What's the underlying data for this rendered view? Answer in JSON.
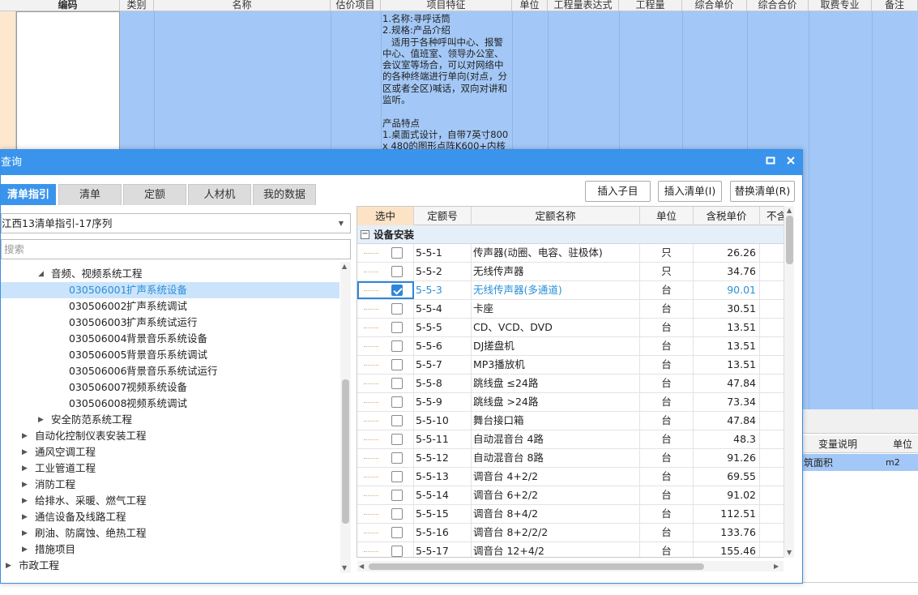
{
  "background": {
    "columns": [
      "编码",
      "类别",
      "名称",
      "估价项目",
      "项目特征",
      "单位",
      "工程量表达式",
      "工程量",
      "综合单价",
      "综合合价",
      "取费专业",
      "备注"
    ],
    "feature_text": "1.名称:寻呼话筒\n2.规格:产品介绍\n   适用于各种呼叫中心、报警中心、值班室、领导办公室、会议室等场合，可以对网络中的各种终端进行单向(对点，分区或者全区)喊话，双向对讲和监听。\n\n产品特点\n1.桌面式设计，自带7英寸800 x 480的图形点阵K600+内核",
    "lower_headers": [
      "变量说明",
      "单位"
    ],
    "lower_row": [
      "筑面积",
      "m2"
    ]
  },
  "dialog": {
    "title": "查询",
    "tabs": [
      "清单指引",
      "清单",
      "定额",
      "人材机",
      "我的数据"
    ],
    "buttons": {
      "insert_child": "插入子目",
      "insert_list": "插入清单(I)",
      "replace_list": "替换清单(R)"
    },
    "dropdown_value": "江西13清单指引-17序列",
    "search_placeholder": "搜索",
    "tree": [
      {
        "arrow": "◢",
        "code": "",
        "label": "音频、视频系统工程",
        "level": 2
      },
      {
        "arrow": "",
        "code": "030506001",
        "label": "扩声系统设备",
        "level": 3,
        "selected": true
      },
      {
        "arrow": "",
        "code": "030506002",
        "label": "扩声系统调试",
        "level": 3
      },
      {
        "arrow": "",
        "code": "030506003",
        "label": "扩声系统试运行",
        "level": 3
      },
      {
        "arrow": "",
        "code": "030506004",
        "label": "背景音乐系统设备",
        "level": 3
      },
      {
        "arrow": "",
        "code": "030506005",
        "label": "背景音乐系统调试",
        "level": 3
      },
      {
        "arrow": "",
        "code": "030506006",
        "label": "背景音乐系统试运行",
        "level": 3
      },
      {
        "arrow": "",
        "code": "030506007",
        "label": "视频系统设备",
        "level": 3
      },
      {
        "arrow": "",
        "code": "030506008",
        "label": "视频系统调试",
        "level": 3
      },
      {
        "arrow": "▶",
        "code": "",
        "label": "安全防范系统工程",
        "level": 2
      },
      {
        "arrow": "▶",
        "code": "",
        "label": "自动化控制仪表安装工程",
        "level": 1
      },
      {
        "arrow": "▶",
        "code": "",
        "label": "通风空调工程",
        "level": 1
      },
      {
        "arrow": "▶",
        "code": "",
        "label": "工业管道工程",
        "level": 1
      },
      {
        "arrow": "▶",
        "code": "",
        "label": "消防工程",
        "level": 1
      },
      {
        "arrow": "▶",
        "code": "",
        "label": "给排水、采暖、燃气工程",
        "level": 1
      },
      {
        "arrow": "▶",
        "code": "",
        "label": "通信设备及线路工程",
        "level": 1
      },
      {
        "arrow": "▶",
        "code": "",
        "label": "刷油、防腐蚀、绝热工程",
        "level": 1
      },
      {
        "arrow": "▶",
        "code": "",
        "label": "措施项目",
        "level": 1
      },
      {
        "arrow": "▶",
        "code": "",
        "label": "市政工程",
        "level": 0
      }
    ],
    "grid": {
      "headers": [
        "选中",
        "定额号",
        "定额名称",
        "单位",
        "含税单价",
        "不含"
      ],
      "group": "设备安装",
      "rows": [
        {
          "code": "5-5-1",
          "name": "传声器(动圈、电容、驻极体)",
          "unit": "只",
          "price": "26.26",
          "checked": false
        },
        {
          "code": "5-5-2",
          "name": "无线传声器",
          "unit": "只",
          "price": "34.76",
          "checked": false
        },
        {
          "code": "5-5-3",
          "name": "无线传声器(多通道)",
          "unit": "台",
          "price": "90.01",
          "checked": true
        },
        {
          "code": "5-5-4",
          "name": "卡座",
          "unit": "台",
          "price": "30.51",
          "checked": false
        },
        {
          "code": "5-5-5",
          "name": "CD、VCD、DVD",
          "unit": "台",
          "price": "13.51",
          "checked": false
        },
        {
          "code": "5-5-6",
          "name": "DJ搓盘机",
          "unit": "台",
          "price": "13.51",
          "checked": false
        },
        {
          "code": "5-5-7",
          "name": "MP3播放机",
          "unit": "台",
          "price": "13.51",
          "checked": false
        },
        {
          "code": "5-5-8",
          "name": "跳线盘 ≤24路",
          "unit": "台",
          "price": "47.84",
          "checked": false
        },
        {
          "code": "5-5-9",
          "name": "跳线盘 >24路",
          "unit": "台",
          "price": "73.34",
          "checked": false
        },
        {
          "code": "5-5-10",
          "name": "舞台接口箱",
          "unit": "台",
          "price": "47.84",
          "checked": false
        },
        {
          "code": "5-5-11",
          "name": "自动混音台 4路",
          "unit": "台",
          "price": "48.3",
          "checked": false
        },
        {
          "code": "5-5-12",
          "name": "自动混音台 8路",
          "unit": "台",
          "price": "91.26",
          "checked": false
        },
        {
          "code": "5-5-13",
          "name": "调音台 4+2/2",
          "unit": "台",
          "price": "69.55",
          "checked": false
        },
        {
          "code": "5-5-14",
          "name": "调音台 6+2/2",
          "unit": "台",
          "price": "91.02",
          "checked": false
        },
        {
          "code": "5-5-15",
          "name": "调音台 8+4/2",
          "unit": "台",
          "price": "112.51",
          "checked": false
        },
        {
          "code": "5-5-16",
          "name": "调音台 8+2/2/2",
          "unit": "台",
          "price": "133.76",
          "checked": false
        },
        {
          "code": "5-5-17",
          "name": "调音台 12+4/2",
          "unit": "台",
          "price": "155.46",
          "checked": false
        }
      ]
    }
  }
}
